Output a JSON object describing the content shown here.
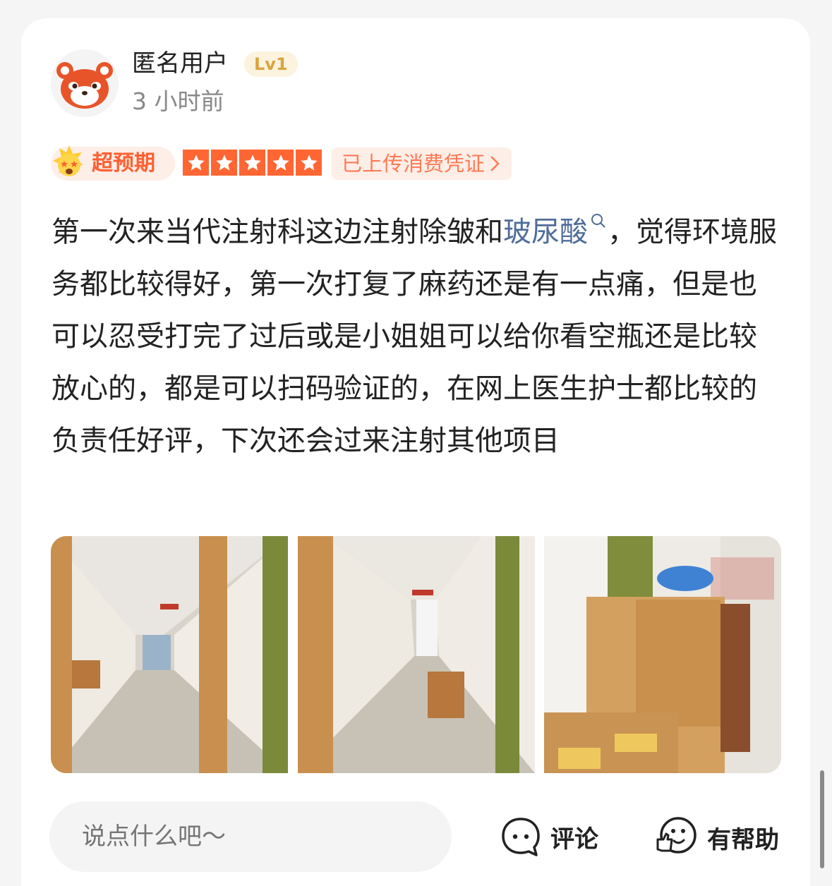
{
  "review": {
    "user": {
      "name": "匿名用户",
      "level": "Lv1",
      "time": "3 小时前",
      "avatar_icon": "red-panda-avatar"
    },
    "tags": {
      "exceed": "超预期",
      "exceed_icon": "star-struck-emoji-icon",
      "rating": 5,
      "receipt": "已上传消费凭证",
      "receipt_icon": "chevron-right-icon"
    },
    "content": {
      "part1": "第一次来当代注射科这边注射除皱和",
      "keyword": "玻尿酸",
      "keyword_icon": "search-icon",
      "part2": "，觉得环境服务都比较得好，第一次打复了麻药还是有一点痛，但是也可以忍受打完了过后或是小姐姐可以给你看空瓶还是比较放心的，都是可以扫码验证的，在网上医生护士都比较的负责任好评，下次还会过来注射其他项目"
    },
    "photos": [
      "corridor-photo-1",
      "corridor-photo-2",
      "shoe-cabinet-photo"
    ]
  },
  "bottom_bar": {
    "input_placeholder": "说点什么吧～",
    "comment_label": "评论",
    "comment_icon": "comment-bubble-icon",
    "helpful_label": "有帮助",
    "helpful_icon": "thumbs-up-face-icon"
  },
  "colors": {
    "accent": "#ff5f32",
    "star": "#ff6633",
    "keyword": "#4f6d9a",
    "level_bg": "#fcf3de",
    "level_text": "#d9a441"
  }
}
